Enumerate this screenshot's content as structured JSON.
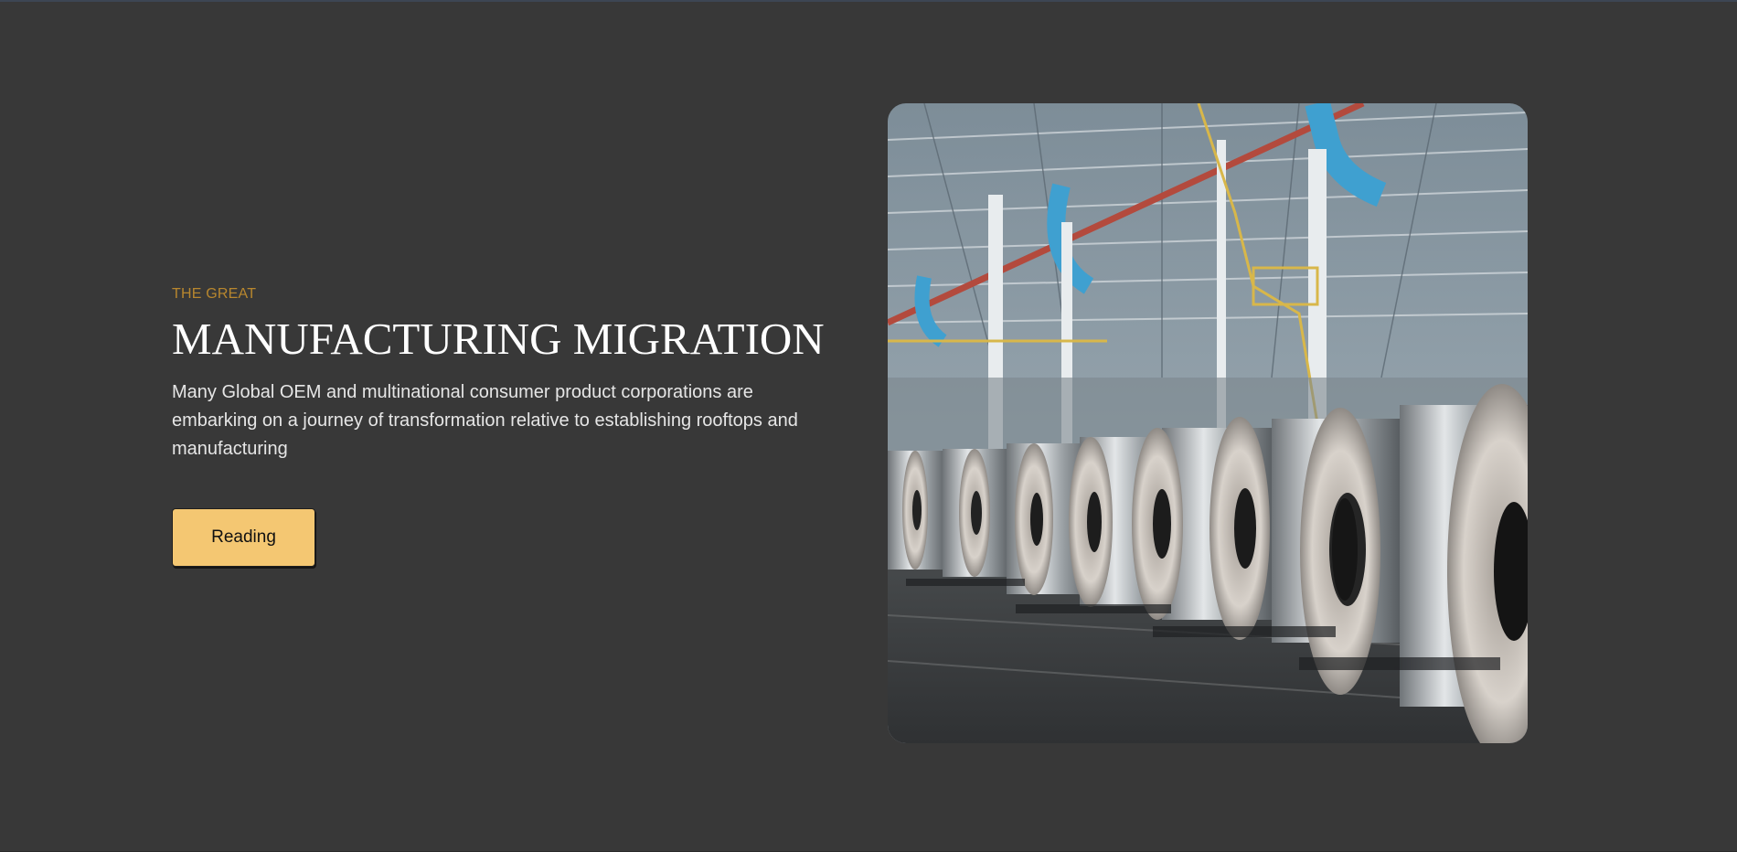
{
  "hero": {
    "eyebrow": "THE GREAT",
    "title": "MANUFACTURING MIGRATION",
    "description": "Many Global OEM and multinational consumer product corporations are embarking on a journey of transformation relative to establishing rooftops and manufacturing",
    "button_label": "Reading"
  },
  "image": {
    "subject": "factory-steel-coils-photo"
  },
  "colors": {
    "background": "#383838",
    "eyebrow": "#b8872e",
    "button": "#f4c772",
    "heading": "#ffffff",
    "body_text": "#e6e6e6"
  }
}
